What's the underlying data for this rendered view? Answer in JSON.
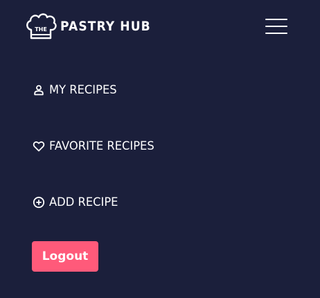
{
  "brand": {
    "logo_badge_text": "THE",
    "name": "PASTRY HUB",
    "icon": "chef-hat-icon"
  },
  "header": {
    "menu_icon": "hamburger-menu-icon"
  },
  "nav": {
    "items": [
      {
        "label": "MY RECIPES",
        "icon": "user-icon"
      },
      {
        "label": "FAVORITE RECIPES",
        "icon": "heart-icon"
      },
      {
        "label": "ADD RECIPE",
        "icon": "plus-circle-icon"
      }
    ]
  },
  "logout": {
    "label": "Logout"
  },
  "colors": {
    "background": "#1b1f3b",
    "text": "#ffffff",
    "accent": "#ff5a7a"
  }
}
